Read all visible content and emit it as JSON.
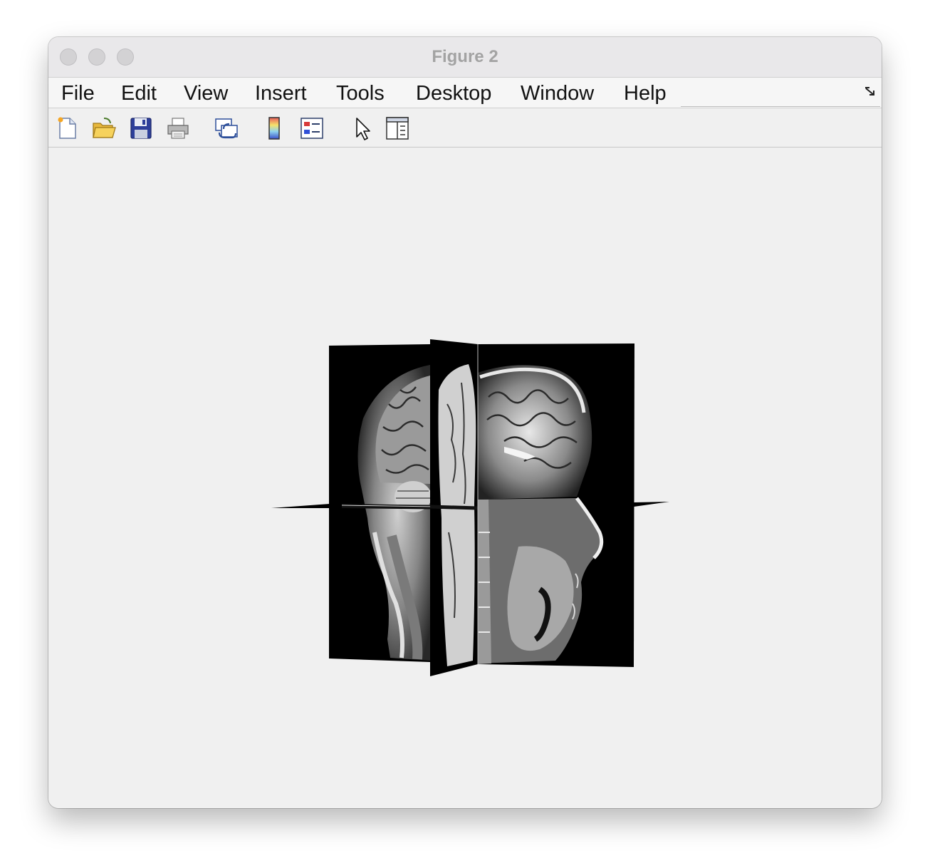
{
  "window": {
    "title": "Figure 2"
  },
  "menubar": {
    "items": [
      {
        "label": "File"
      },
      {
        "label": "Edit"
      },
      {
        "label": "View"
      },
      {
        "label": "Insert"
      },
      {
        "label": "Tools"
      },
      {
        "label": "Desktop"
      },
      {
        "label": "Window"
      },
      {
        "label": "Help"
      }
    ]
  },
  "toolbar": {
    "buttons": [
      {
        "icon": "new-figure-icon"
      },
      {
        "icon": "open-file-icon"
      },
      {
        "icon": "save-icon"
      },
      {
        "icon": "print-icon"
      },
      {
        "icon": "link-plot-icon"
      },
      {
        "icon": "colorbar-icon"
      },
      {
        "icon": "legend-icon"
      },
      {
        "icon": "edit-plot-cursor-icon"
      },
      {
        "icon": "property-inspector-icon"
      }
    ]
  },
  "figure": {
    "content": "mri-orthogonal-slices",
    "colors": {
      "slice": "#000000",
      "background": "#f0f0f0"
    }
  }
}
